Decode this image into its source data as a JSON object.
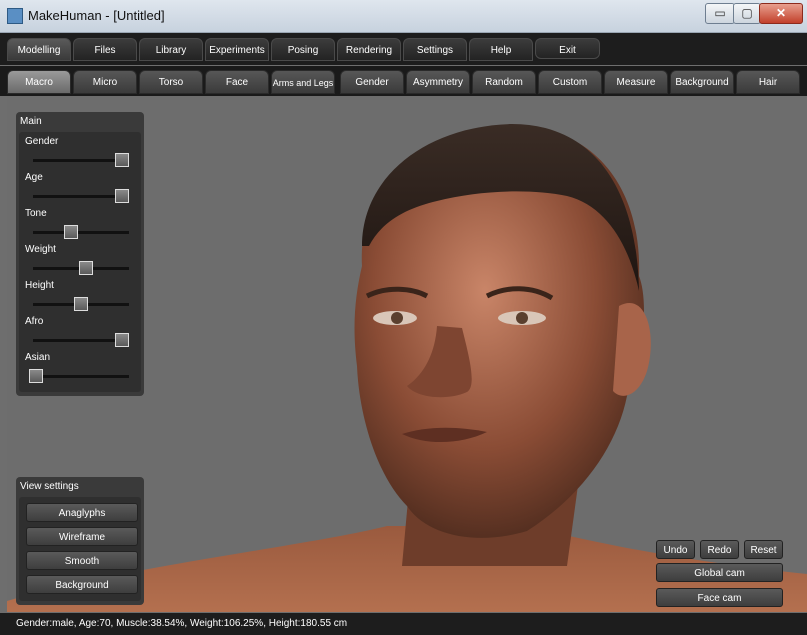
{
  "window": {
    "title": "MakeHuman - [Untitled]",
    "minimize_glyph": "▭",
    "maximize_glyph": "▢",
    "close_glyph": "✕"
  },
  "main_tabs": [
    "Modelling",
    "Files",
    "Library",
    "Experiments",
    "Posing",
    "Rendering",
    "Settings",
    "Help",
    "Exit"
  ],
  "sub_tabs": [
    "Macro",
    "Micro",
    "Torso",
    "Face",
    "Arms and Legs",
    "Gender",
    "Asymmetry",
    "Random",
    "Custom",
    "Measure",
    "Background",
    "Hair"
  ],
  "main_panel": {
    "title": "Main",
    "sliders": [
      {
        "label": "Gender",
        "value": 1.0
      },
      {
        "label": "Age",
        "value": 1.0
      },
      {
        "label": "Tone",
        "value": 0.38
      },
      {
        "label": "Weight",
        "value": 0.56
      },
      {
        "label": "Height",
        "value": 0.5
      },
      {
        "label": "Afro",
        "value": 1.0
      },
      {
        "label": "Asian",
        "value": 0.0
      }
    ]
  },
  "view_settings": {
    "title": "View settings",
    "buttons": [
      "Anaglyphs",
      "Wireframe",
      "Smooth",
      "Background"
    ]
  },
  "controls": {
    "undo": "Undo",
    "redo": "Redo",
    "reset": "Reset",
    "global_cam": "Global cam",
    "face_cam": "Face cam"
  },
  "status": "Gender:male, Age:70, Muscle:38.54%, Weight:106.25%, Height:180.55 cm",
  "colors": {
    "viewport_bg": "#6d6d6d",
    "skin_light": "#c07b5f",
    "skin_dark": "#4a2a1c",
    "hair": "#2b201b"
  }
}
